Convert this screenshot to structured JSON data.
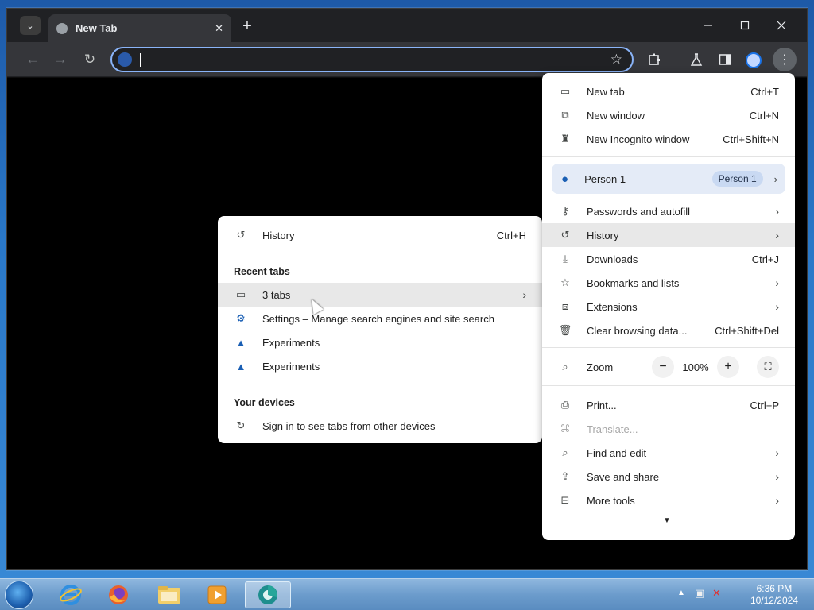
{
  "browser": {
    "tab_title": "New Tab",
    "tab_close": "✕",
    "new_tab_symbol": "+",
    "omnibox_value": "",
    "colors": {
      "frame": "#202124",
      "toolbar": "#35363a",
      "accent": "#8ab4f8"
    }
  },
  "main_menu": {
    "items_top": [
      {
        "icon": "new-tab-icon",
        "label": "New tab",
        "shortcut": "Ctrl+T"
      },
      {
        "icon": "new-window-icon",
        "label": "New window",
        "shortcut": "Ctrl+N"
      },
      {
        "icon": "incognito-icon",
        "label": "New Incognito window",
        "shortcut": "Ctrl+Shift+N"
      }
    ],
    "person": {
      "label": "Person 1",
      "chip": "Person 1"
    },
    "items_mid": [
      {
        "icon": "key-icon",
        "label": "Passwords and autofill",
        "shortcut": ""
      },
      {
        "icon": "history-icon",
        "label": "History",
        "shortcut": ""
      },
      {
        "icon": "download-icon",
        "label": "Downloads",
        "shortcut": "Ctrl+J"
      },
      {
        "icon": "star-icon",
        "label": "Bookmarks and lists",
        "shortcut": ""
      },
      {
        "icon": "extensions-icon",
        "label": "Extensions",
        "shortcut": ""
      },
      {
        "icon": "trash-icon",
        "label": "Clear browsing data...",
        "shortcut": "Ctrl+Shift+Del"
      }
    ],
    "zoom": {
      "label": "Zoom",
      "minus": "−",
      "value": "100%",
      "plus": "+"
    },
    "items_bottom": [
      {
        "icon": "print-icon",
        "label": "Print...",
        "shortcut": "Ctrl+P"
      },
      {
        "icon": "translate-icon",
        "label": "Translate...",
        "shortcut": ""
      },
      {
        "icon": "find-icon",
        "label": "Find and edit",
        "shortcut": ""
      },
      {
        "icon": "save-share-icon",
        "label": "Save and share",
        "shortcut": ""
      },
      {
        "icon": "toolbox-icon",
        "label": "More tools",
        "shortcut": ""
      }
    ]
  },
  "history_menu": {
    "history": {
      "label": "History",
      "shortcut": "Ctrl+H"
    },
    "recent_heading": "Recent tabs",
    "recent": [
      {
        "icon": "window-icon",
        "label": "3 tabs"
      },
      {
        "icon": "gear-icon",
        "label": "Settings – Manage search engines and site search"
      },
      {
        "icon": "flask-icon",
        "label": "Experiments"
      },
      {
        "icon": "flask-icon",
        "label": "Experiments"
      }
    ],
    "devices_heading": "Your devices",
    "devices_item": "Sign in to see tabs from other devices"
  },
  "taskbar": {
    "time": "6:36 PM",
    "date": "10/12/2024"
  }
}
